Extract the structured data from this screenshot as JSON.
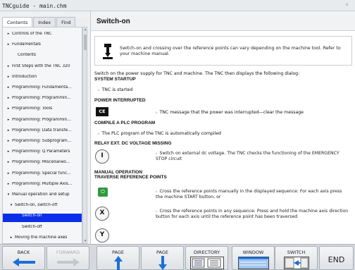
{
  "window": {
    "title": "TNCguide - main.chm",
    "close_glyph": "×"
  },
  "sidebar": {
    "tabs": [
      {
        "label": "Contents",
        "active": true
      },
      {
        "label": "Index",
        "active": false
      },
      {
        "label": "Find",
        "active": false
      }
    ],
    "items": [
      {
        "label": "Controls of the TNC",
        "arrow": "▸"
      },
      {
        "label": "Fundamentals",
        "arrow": "▸"
      },
      {
        "label": "Contents",
        "arrow": ""
      },
      {
        "label": "First Steps with the TNC 320",
        "arrow": "▸"
      },
      {
        "label": "Introduction",
        "arrow": "▸"
      },
      {
        "label": "Programming: Fundamenta...",
        "arrow": "▸"
      },
      {
        "label": "Programming: Programmin...",
        "arrow": "▸"
      },
      {
        "label": "Programming: Tools",
        "arrow": "▸"
      },
      {
        "label": "Programming: Programmin...",
        "arrow": "▸"
      },
      {
        "label": "Programming: Data transfe...",
        "arrow": "▸"
      },
      {
        "label": "Programming: Subprogram...",
        "arrow": "▸"
      },
      {
        "label": "Programming: Q Parameters",
        "arrow": "▸"
      },
      {
        "label": "Programming: Miscellaneo...",
        "arrow": "▸"
      },
      {
        "label": "Programming: Special func...",
        "arrow": "▸"
      },
      {
        "label": "Programming: Multiple Axis...",
        "arrow": "▸"
      },
      {
        "label": "Manual operation and setup",
        "arrow": "▾"
      },
      {
        "label": "Switch-on, switch-off",
        "arrow": "▾"
      },
      {
        "label": "Switch-on",
        "arrow": "",
        "selected": true
      },
      {
        "label": "Switch-off",
        "arrow": ""
      },
      {
        "label": "Moving the machine axes",
        "arrow": "▸"
      }
    ]
  },
  "content": {
    "title": "Switch-on",
    "note": "Switch-on and crossing over the reference points can vary depending on the machine tool. Refer to your machine manual.",
    "intro": "Switch on the power supply for TNC and machine. The TNC then displays the following dialog:",
    "system_startup": "SYSTEM STARTUP",
    "tnc_started": "TNC is started",
    "power_interrupted": "POWER INTERRUPTED",
    "ce_key": "CE",
    "power_msg": "TNC message that the power was interrupted—clear the message",
    "compile_plc": "COMPILE A PLC PROGRAM",
    "plc_msg": "The PLC program of the TNC is automatically compiled",
    "relay": "RELAY EXT. DC VOLTAGE MISSING",
    "relay_key": "I",
    "relay_msg": "Switch on external dc voltage. The TNC checks the functioning of the EMERGENCY STOP circuit",
    "manual_op": "MANUAL OPERATION",
    "traverse": "TRAVERSE REFERENCE POINTS",
    "start_key": "⏻",
    "cross_msg1": "Cross the reference points manually in the displayed sequence: For each axis press the machine START button, or",
    "x_key": "X",
    "cross_msg2": "Cross the reference points in any sequence: Press and hold the machine axis direction button for each axis until the reference point has been traversed",
    "y_key": "Y",
    "arrow_glyph": "▹"
  },
  "softkeys": [
    {
      "label": "BACK",
      "enabled": true,
      "icon": "left-arrow-icon"
    },
    {
      "label": "FORWARD",
      "enabled": false,
      "icon": "right-arrow-icon"
    },
    {
      "label": "PAGE",
      "enabled": true,
      "icon": "up-arrow-icon"
    },
    {
      "label": "PAGE",
      "enabled": true,
      "icon": "down-arrow-icon"
    },
    {
      "label": "DIRECTORY",
      "enabled": true,
      "icon": "directory-icon"
    },
    {
      "label": "WINDOW",
      "enabled": true,
      "icon": "window-icon"
    },
    {
      "label": "SWITCH",
      "enabled": true,
      "icon": "switch-icon"
    },
    {
      "label": "END",
      "enabled": true,
      "icon": ""
    }
  ],
  "colors": {
    "selection": "#0b2fe8",
    "arrow_blue": "#1b6fd6",
    "start_green": "#2f9a3e"
  }
}
